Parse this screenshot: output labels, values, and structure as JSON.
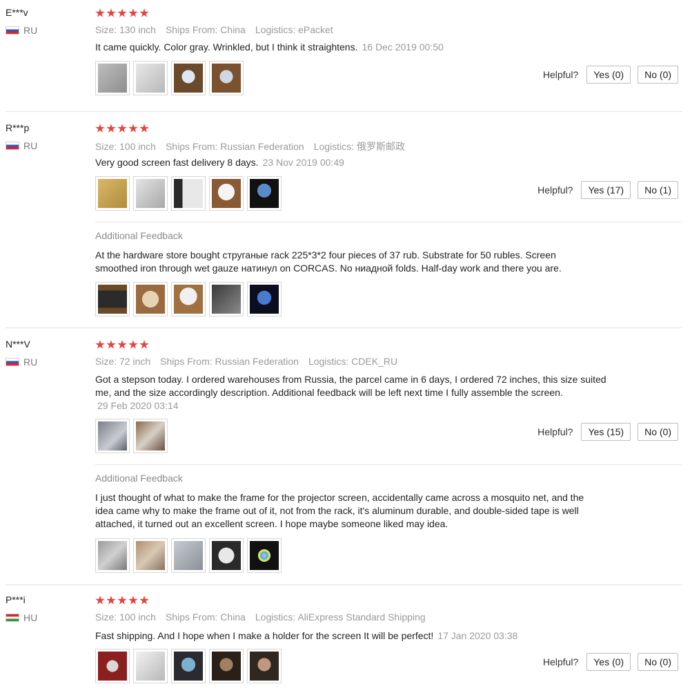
{
  "colors": {
    "star": "#e8433e",
    "meta": "#9a9a9a",
    "divider": "#e2e2e2"
  },
  "helpful_label": "Helpful?",
  "additional_feedback_label": "Additional Feedback",
  "reviews": [
    {
      "user": "E***v",
      "country": "RU",
      "stars": 5,
      "size": "Size: 130 inch",
      "ships_from": "Ships From: China",
      "logistics": "Logistics: ePacket",
      "text": "It came quickly. Color gray. Wrinkled, but I think it straightens.",
      "date": "16 Dec 2019 00:50",
      "photos": 4,
      "yes": "Yes (0)",
      "no": "No (0)"
    },
    {
      "user": "R***p",
      "country": "RU",
      "stars": 5,
      "size": "Size: 100 inch",
      "ships_from": "Ships From: Russian Federation",
      "logistics": "Logistics: 俄罗斯邮政",
      "text": "Very good screen fast delivery 8 days.",
      "date": "23 Nov 2019 00:49",
      "photos": 5,
      "yes": "Yes (17)",
      "no": "No (1)",
      "additional_text": "At the hardware store bought струганые rack 225*3*2 four pieces of 37 rub. Substrate for 50 rubles. Screen smoothed iron through wet gauze натинул on CORCAS. No ниадной folds. Half-day work and there you are.",
      "additional_photos": 5
    },
    {
      "user": "N***V",
      "country": "RU",
      "stars": 5,
      "size": "Size: 72 inch",
      "ships_from": "Ships From: Russian Federation",
      "logistics": "Logistics: CDEK_RU",
      "text": "Got a stepson today. I ordered warehouses from Russia, the parcel came in 6 days, I ordered 72 inches, this size suited me, and the size accordingly description. Additional feedback will be left next time I fully assemble the screen.",
      "date": "29 Feb 2020 03:14",
      "photos": 2,
      "yes": "Yes (15)",
      "no": "No (0)",
      "additional_text": "I just thought of what to make the frame for the projector screen, accidentally came across a mosquito net, and the idea came why to make the frame out of it, not from the rack, it's aluminum durable, and double-sided tape is well attached, it turned out an excellent screen. I hope maybe someone liked may idea.",
      "additional_photos": 5
    },
    {
      "user": "P***i",
      "country": "HU",
      "stars": 5,
      "size": "Size: 100 inch",
      "ships_from": "Ships From: China",
      "logistics": "Logistics: AliExpress Standard Shipping",
      "text": "Fast shipping. And I hope when I make a holder for the screen It will be perfect!",
      "date": "17 Jan 2020 03:38",
      "photos": 5,
      "yes": "Yes (0)",
      "no": "No (0)"
    }
  ]
}
